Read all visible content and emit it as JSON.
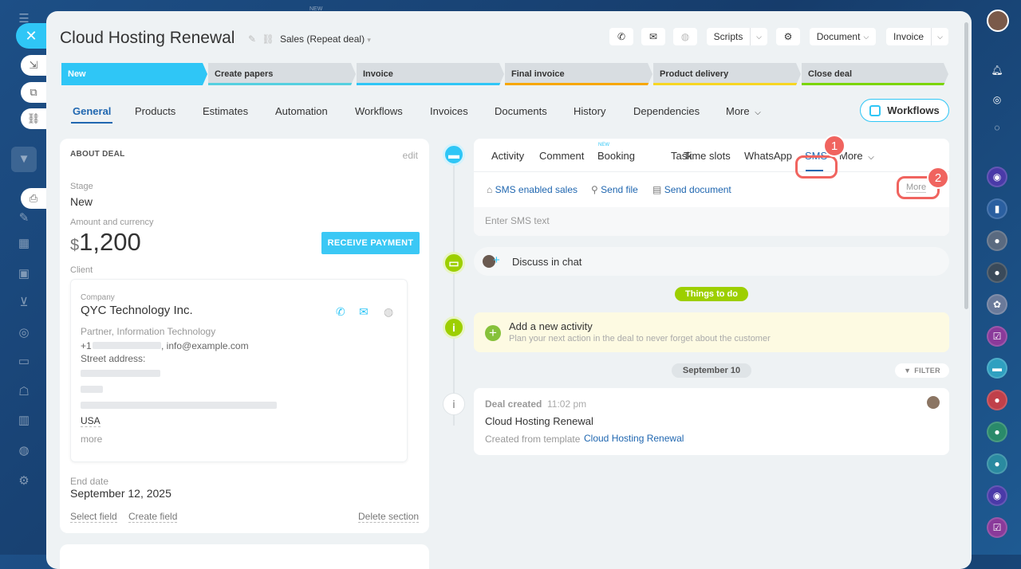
{
  "app": {
    "top_badge": "NEW"
  },
  "deal": {
    "title": "Cloud Hosting Renewal",
    "pipeline": "Sales (Repeat deal)"
  },
  "header_buttons": {
    "scripts": "Scripts",
    "document": "Document",
    "invoice": "Invoice"
  },
  "stages": [
    {
      "label": "New",
      "color": "#2fc6f6"
    },
    {
      "label": "Create papers",
      "color": "#55d0e0"
    },
    {
      "label": "Invoice",
      "color": "#2fc6f6"
    },
    {
      "label": "Final invoice",
      "color": "#f7a700"
    },
    {
      "label": "Product delivery",
      "color": "#f7d622"
    },
    {
      "label": "Close deal",
      "color": "#7bd500"
    }
  ],
  "tabs": [
    "General",
    "Products",
    "Estimates",
    "Automation",
    "Workflows",
    "Invoices",
    "Documents",
    "History",
    "Dependencies",
    "More"
  ],
  "workflows_button": "Workflows",
  "about": {
    "title": "ABOUT DEAL",
    "edit": "edit",
    "stage_label": "Stage",
    "stage_value": "New",
    "amount_label": "Amount and currency",
    "currency": "$",
    "amount": "1,200",
    "pay_button": "RECEIVE PAYMENT",
    "client_label": "Client",
    "company_label": "Company",
    "company_name": "QYC Technology Inc.",
    "company_type": "Partner, Information Technology",
    "phone_prefix": "+1",
    "email": ", info@example.com",
    "street_label": "Street address:",
    "country": "USA",
    "more": "more",
    "end_date_label": "End date",
    "end_date_value": "September 12, 2025",
    "select_field": "Select field",
    "create_field": "Create field",
    "delete_section": "Delete section"
  },
  "editor": {
    "tabs": [
      "Activity",
      "Comment",
      "Booking",
      "Task",
      "Time slots",
      "WhatsApp",
      "SMS",
      "More"
    ],
    "booking_badge": "NEW",
    "actions": [
      "SMS enabled sales",
      "Send file",
      "Send document"
    ],
    "more": "More",
    "placeholder": "Enter SMS text"
  },
  "chat": {
    "label": "Discuss in chat"
  },
  "todo": {
    "pill": "Things to do",
    "title": "Add a new activity",
    "subtitle": "Plan your next action in the deal to never forget about the customer"
  },
  "date_pill": "September 10",
  "filter": "FILTER",
  "event": {
    "title": "Deal created",
    "time": "11:02 pm",
    "name": "Cloud Hosting Renewal",
    "created_from": "Created from template",
    "template_link": "Cloud Hosting Renewal"
  },
  "annotations": [
    "1",
    "2"
  ]
}
